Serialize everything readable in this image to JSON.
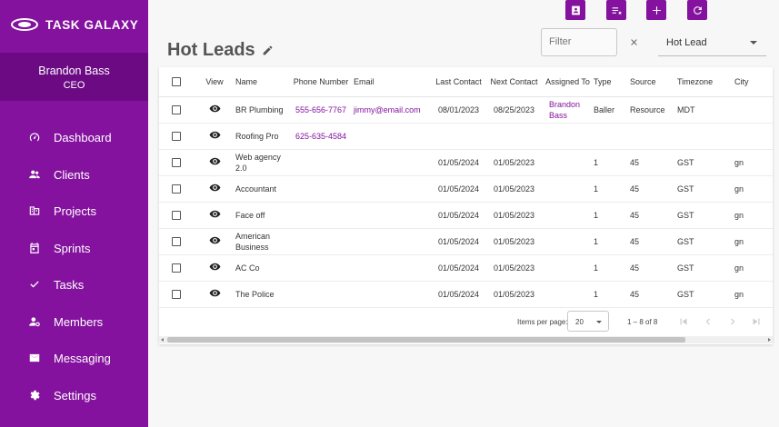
{
  "app": {
    "brand": "TASK GALAXY"
  },
  "user": {
    "name": "Brandon Bass",
    "role": "CEO"
  },
  "nav": [
    {
      "label": "Dashboard",
      "icon": "dashboard-icon"
    },
    {
      "label": "Clients",
      "icon": "clients-icon"
    },
    {
      "label": "Projects",
      "icon": "projects-icon"
    },
    {
      "label": "Sprints",
      "icon": "calendar-icon"
    },
    {
      "label": "Tasks",
      "icon": "check-icon"
    },
    {
      "label": "Members",
      "icon": "members-icon"
    },
    {
      "label": "Messaging",
      "icon": "mail-icon"
    },
    {
      "label": "Settings",
      "icon": "gear-icon"
    }
  ],
  "toolbar": {
    "buttons": [
      "contact-card-icon",
      "playlist-remove-icon",
      "plus-icon",
      "refresh-icon"
    ]
  },
  "page": {
    "title": "Hot Leads"
  },
  "filter": {
    "placeholder": "Filter",
    "value": ""
  },
  "view_select": {
    "value": "Hot Lead"
  },
  "table": {
    "columns": [
      "View",
      "Name",
      "Phone Number",
      "Email",
      "Last Contact",
      "Next Contact",
      "Assigned To",
      "Type",
      "Source",
      "Timezone",
      "City"
    ],
    "rows": [
      {
        "name": "BR Plumbing",
        "phone": "555-656-7767",
        "email": "jimmy@email.com",
        "last": "08/01/2023",
        "next": "08/25/2023",
        "assigned": "Brandon Bass",
        "type": "Baller",
        "source": "Resource",
        "tz": "MDT",
        "city": ""
      },
      {
        "name": "Roofing Pro",
        "phone": "625-635-4584",
        "email": "",
        "last": "",
        "next": "",
        "assigned": "",
        "type": "",
        "source": "",
        "tz": "",
        "city": ""
      },
      {
        "name": "Web agency 2.0",
        "phone": "",
        "email": "",
        "last": "01/05/2024",
        "next": "01/05/2023",
        "assigned": "",
        "type": "1",
        "source": "45",
        "tz": "GST",
        "city": "gn"
      },
      {
        "name": "Accountant",
        "phone": "",
        "email": "",
        "last": "01/05/2024",
        "next": "01/05/2023",
        "assigned": "",
        "type": "1",
        "source": "45",
        "tz": "GST",
        "city": "gn"
      },
      {
        "name": "Face off",
        "phone": "",
        "email": "",
        "last": "01/05/2024",
        "next": "01/05/2023",
        "assigned": "",
        "type": "1",
        "source": "45",
        "tz": "GST",
        "city": "gn"
      },
      {
        "name": "American Business",
        "phone": "",
        "email": "",
        "last": "01/05/2024",
        "next": "01/05/2023",
        "assigned": "",
        "type": "1",
        "source": "45",
        "tz": "GST",
        "city": "gn"
      },
      {
        "name": "AC Co",
        "phone": "",
        "email": "",
        "last": "01/05/2024",
        "next": "01/05/2023",
        "assigned": "",
        "type": "1",
        "source": "45",
        "tz": "GST",
        "city": "gn"
      },
      {
        "name": "The Police",
        "phone": "",
        "email": "",
        "last": "01/05/2024",
        "next": "01/05/2023",
        "assigned": "",
        "type": "1",
        "source": "45",
        "tz": "GST",
        "city": "gn"
      }
    ]
  },
  "paginator": {
    "items_per_page_label": "Items per page:",
    "items_per_page": "20",
    "range": "1 – 8 of 8"
  },
  "colors": {
    "primary": "#84129e",
    "sidebar_dark": "#6b0a83"
  }
}
